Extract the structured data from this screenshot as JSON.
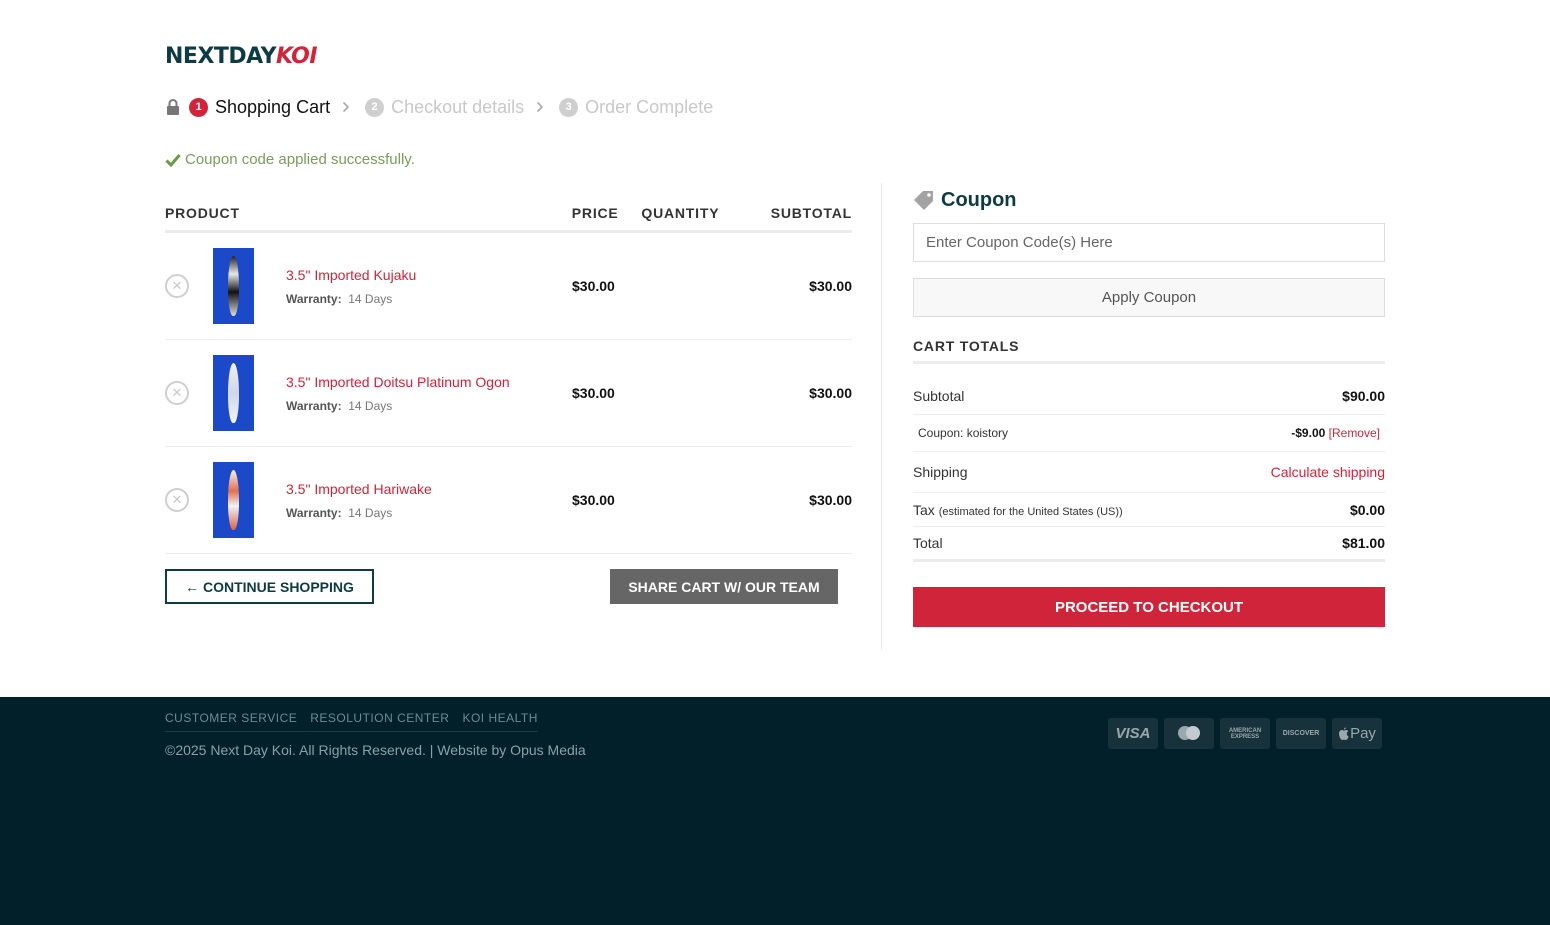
{
  "logo": {
    "part1": "NEXTDAY",
    "part2": "KOI"
  },
  "steps": [
    {
      "num": "1",
      "label": "Shopping Cart"
    },
    {
      "num": "2",
      "label": "Checkout details"
    },
    {
      "num": "3",
      "label": "Order Complete"
    }
  ],
  "notice": "Coupon code applied successfully.",
  "cart": {
    "headers": {
      "product": "PRODUCT",
      "price": "PRICE",
      "quantity": "QUANTITY",
      "subtotal": "SUBTOTAL"
    },
    "items": [
      {
        "name": "3.5\" Imported Kujaku",
        "warranty_label": "Warranty:",
        "warranty": "14 Days",
        "price": "$30.00",
        "subtotal": "$30.00"
      },
      {
        "name": "3.5\" Imported Doitsu Platinum Ogon",
        "warranty_label": "Warranty:",
        "warranty": "14 Days",
        "price": "$30.00",
        "subtotal": "$30.00"
      },
      {
        "name": "3.5\" Imported Hariwake",
        "warranty_label": "Warranty:",
        "warranty": "14 Days",
        "price": "$30.00",
        "subtotal": "$30.00"
      }
    ],
    "continue_label": "← CONTINUE SHOPPING",
    "share_label": "SHARE CART W/ OUR TEAM"
  },
  "coupon": {
    "title": "Coupon",
    "placeholder": "Enter Coupon Code(s) Here",
    "apply_label": "Apply Coupon"
  },
  "totals": {
    "heading": "CART TOTALS",
    "subtotal_label": "Subtotal",
    "subtotal": "$90.00",
    "coupon_label": "Coupon: koistory",
    "coupon_amount": "-$9.00",
    "coupon_remove": "[Remove]",
    "shipping_label": "Shipping",
    "shipping_value": "Calculate shipping",
    "tax_label": "Tax",
    "tax_note": "(estimated for the United States (US))",
    "tax": "$0.00",
    "total_label": "Total",
    "total": "$81.00",
    "checkout_label": "PROCEED TO CHECKOUT"
  },
  "footer": {
    "links": [
      "CUSTOMER SERVICE",
      "RESOLUTION CENTER",
      "KOI HEALTH"
    ],
    "copyright": "©2025 Next Day Koi. All Rights Reserved. | Website by Opus Media",
    "cards": [
      "VISA",
      "mastercard",
      "AMERICAN EXPRESS",
      "DISCOVER",
      "Pay"
    ]
  },
  "colors": {
    "brand_dark": "#0e3b43",
    "brand_red": "#d0243a",
    "footer_bg": "#02202a",
    "success": "#7a9c59"
  }
}
